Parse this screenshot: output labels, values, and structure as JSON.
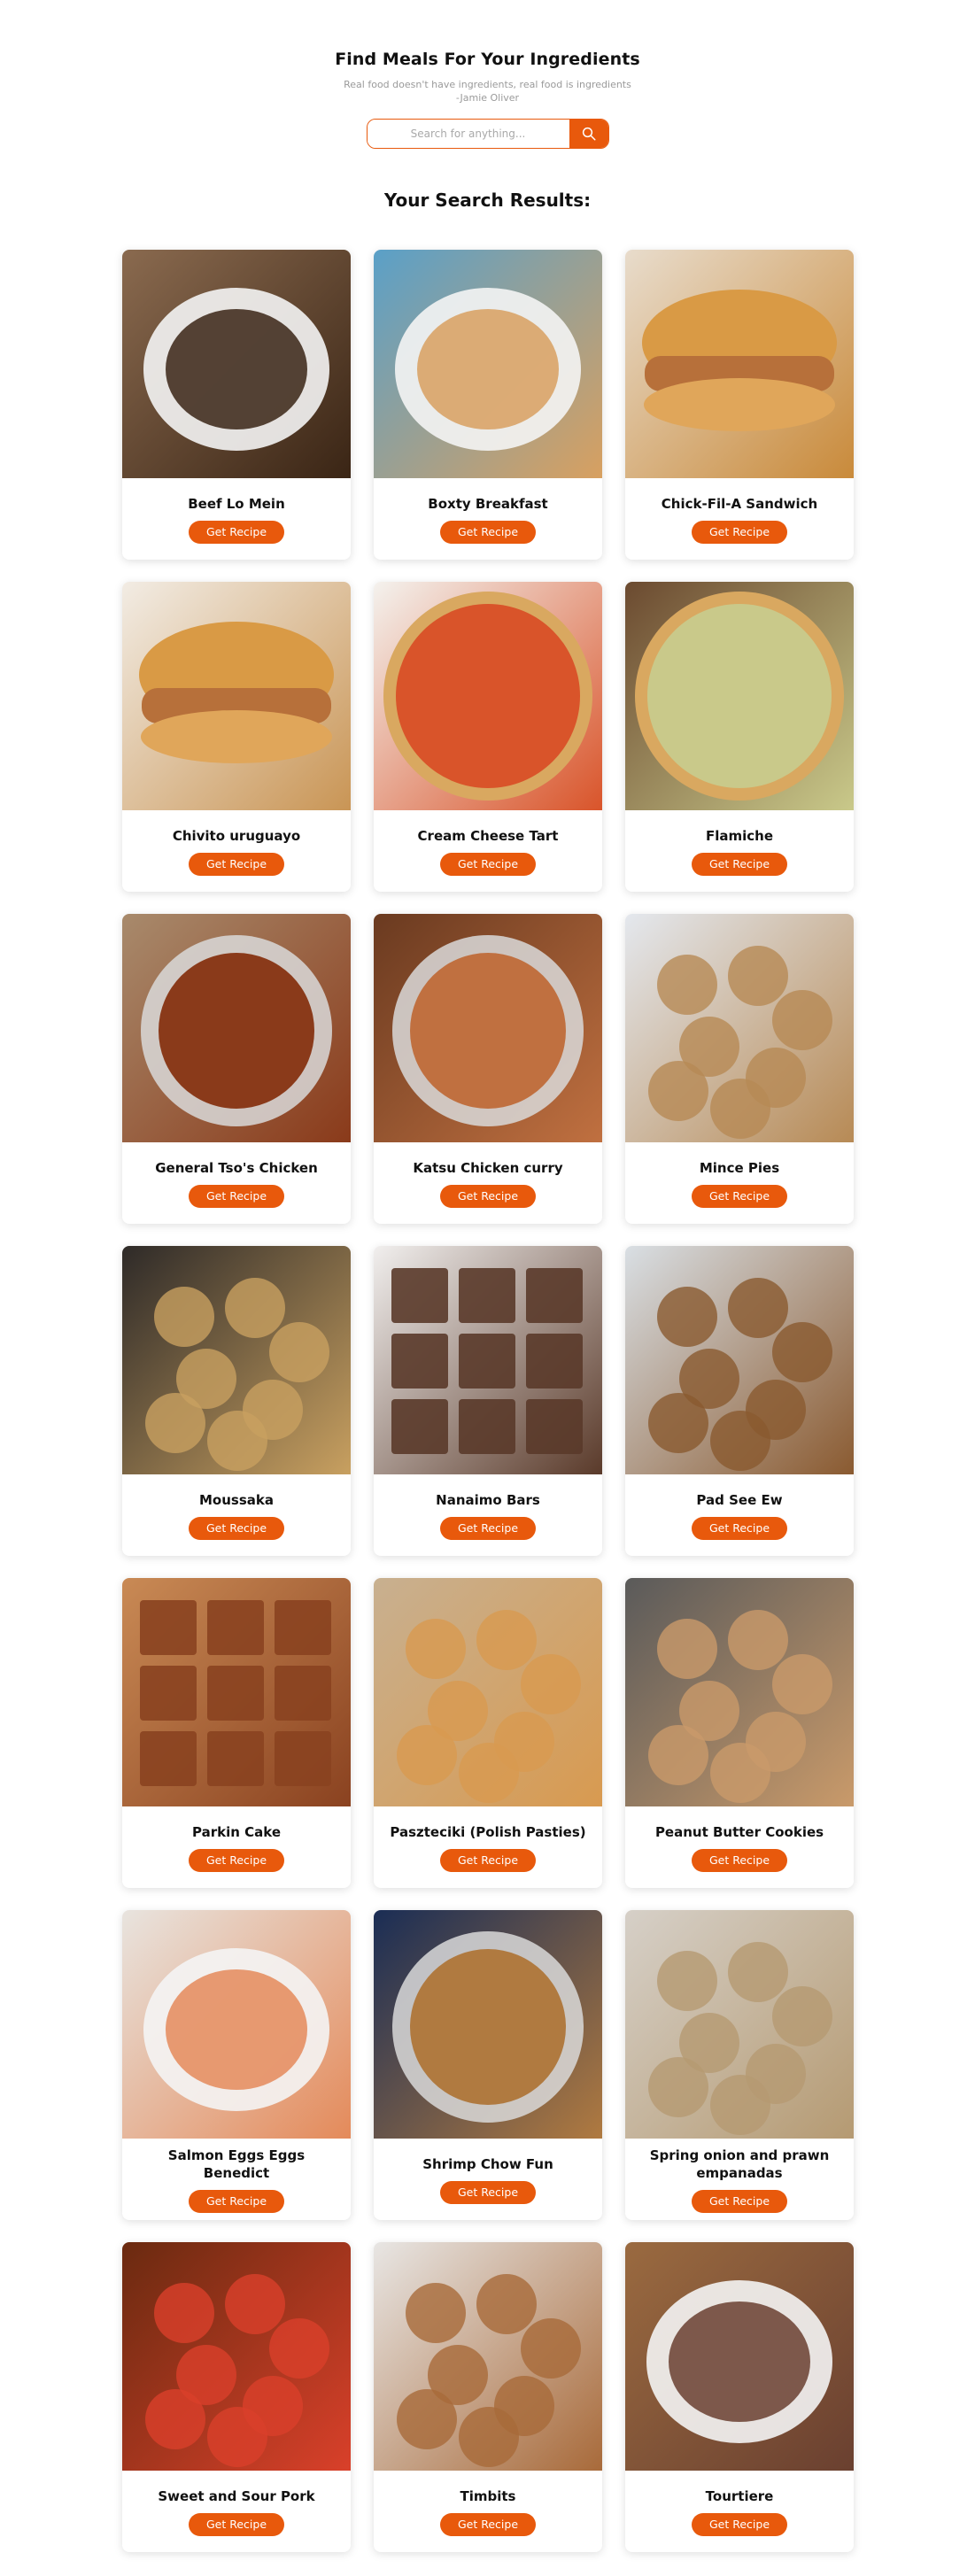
{
  "header": {
    "title": "Find Meals For Your Ingredients",
    "quote_line1": "Real food doesn't have ingredients, real food is ingredients",
    "quote_line2": "-Jamie Oliver"
  },
  "search": {
    "placeholder": "Search for anything...",
    "icon": "search-icon"
  },
  "results_title": "Your Search Results:",
  "colors": {
    "accent": "#e8590c",
    "card_bg": "#ffffff",
    "text": "#111111",
    "muted": "#9a9a9a"
  },
  "button_label": "Get Recipe",
  "meals": [
    {
      "name": "Beef Lo Mein",
      "bg": [
        "#8a6a4f",
        "#3a2515"
      ],
      "shape": "plate-oval"
    },
    {
      "name": "Boxty Breakfast",
      "bg": [
        "#5aa0c8",
        "#d8a060"
      ],
      "shape": "plate-round"
    },
    {
      "name": "Chick-Fil-A Sandwich",
      "bg": [
        "#e8dccc",
        "#c98a3a"
      ],
      "shape": "burger"
    },
    {
      "name": "Chivito uruguayo",
      "bg": [
        "#f2ece4",
        "#c99555"
      ],
      "shape": "sandwich"
    },
    {
      "name": "Cream Cheese Tart",
      "bg": [
        "#f4f2ee",
        "#d9542a"
      ],
      "shape": "tart-red"
    },
    {
      "name": "Flamiche",
      "bg": [
        "#6b4a30",
        "#c9c98a"
      ],
      "shape": "tart-green"
    },
    {
      "name": "General Tso's Chicken",
      "bg": [
        "#a88a6c",
        "#8a3a1a"
      ],
      "shape": "bowl"
    },
    {
      "name": "Katsu Chicken curry",
      "bg": [
        "#6a3a20",
        "#c07040"
      ],
      "shape": "bowl-dark"
    },
    {
      "name": "Mince Pies",
      "bg": [
        "#e4e8ee",
        "#b78a55"
      ],
      "shape": "pies"
    },
    {
      "name": "Moussaka",
      "bg": [
        "#2e2a28",
        "#c8a060"
      ],
      "shape": "skillet"
    },
    {
      "name": "Nanaimo Bars",
      "bg": [
        "#f1efee",
        "#5a3a2a"
      ],
      "shape": "bars"
    },
    {
      "name": "Pad See Ew",
      "bg": [
        "#d9dfe4",
        "#8a5a30"
      ],
      "shape": "noodles"
    },
    {
      "name": "Parkin Cake",
      "bg": [
        "#c98a55",
        "#8a4220"
      ],
      "shape": "cake"
    },
    {
      "name": "Paszteciki (Polish Pasties)",
      "bg": [
        "#c8b090",
        "#d89a50"
      ],
      "shape": "rolls"
    },
    {
      "name": "Peanut Butter Cookies",
      "bg": [
        "#5a5a5a",
        "#c99a6a"
      ],
      "shape": "cookies"
    },
    {
      "name": "Salmon Eggs Eggs Benedict",
      "bg": [
        "#e8e4df",
        "#e48a5a"
      ],
      "shape": "benedict"
    },
    {
      "name": "Shrimp Chow Fun",
      "bg": [
        "#1a2d55",
        "#b07a40"
      ],
      "shape": "noodles-dark"
    },
    {
      "name": "Spring onion and prawn empanadas",
      "bg": [
        "#d6d0c8",
        "#b59a72"
      ],
      "shape": "empanada"
    },
    {
      "name": "Sweet and Sour Pork",
      "bg": [
        "#6a2a10",
        "#d9402a"
      ],
      "shape": "pork"
    },
    {
      "name": "Timbits",
      "bg": [
        "#e8e6e4",
        "#a86a3a"
      ],
      "shape": "timbits"
    },
    {
      "name": "Tourtiere",
      "bg": [
        "#9a6a40",
        "#6a4030"
      ],
      "shape": "pie-slice"
    }
  ]
}
